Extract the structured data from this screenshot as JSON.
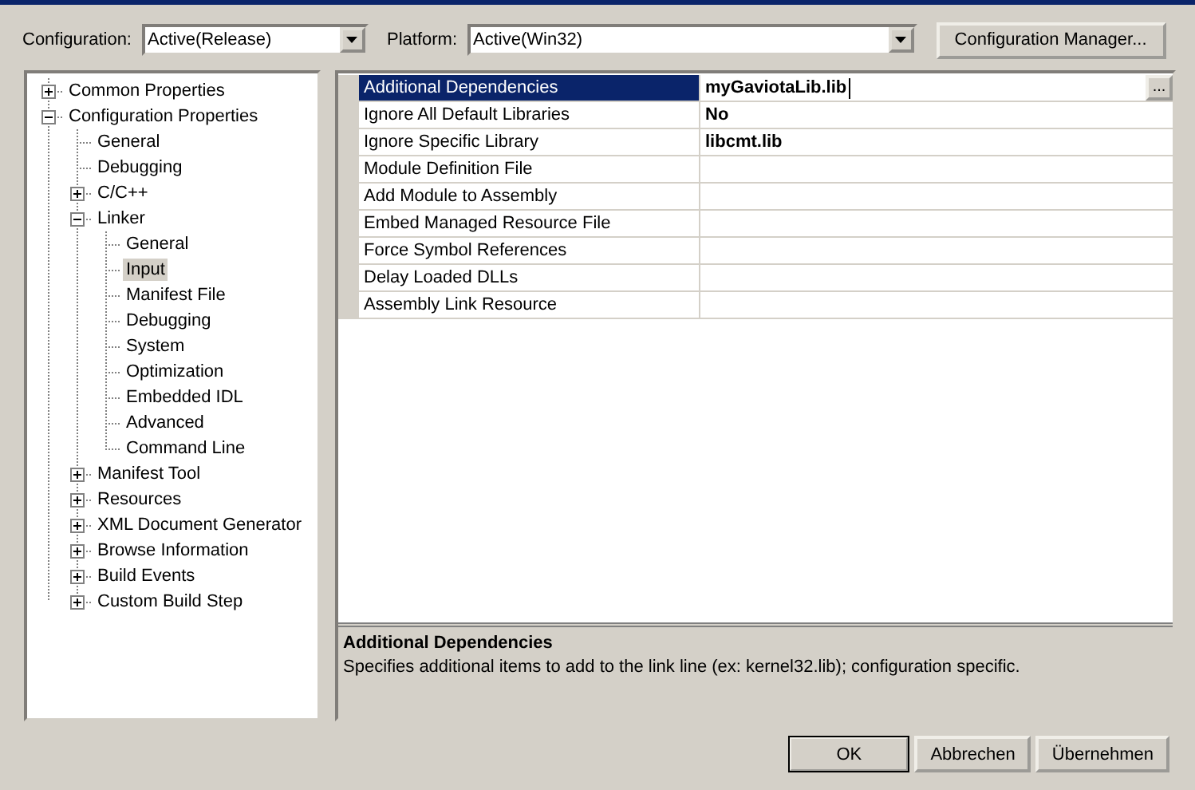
{
  "toolbar": {
    "configuration_label": "Configuration:",
    "configuration": "Active(Release)",
    "platform_label": "Platform:",
    "platform": "Active(Win32)",
    "manager_button": "Configuration Manager..."
  },
  "tree": [
    {
      "label": "Common Properties",
      "expanded": false,
      "selected": false
    },
    {
      "label": "Configuration Properties",
      "expanded": true,
      "selected": false,
      "children": [
        {
          "label": "General",
          "selected": false
        },
        {
          "label": "Debugging",
          "selected": false
        },
        {
          "label": "C/C++",
          "expanded": false,
          "selected": false
        },
        {
          "label": "Linker",
          "expanded": true,
          "selected": false,
          "children": [
            {
              "label": "General",
              "selected": false
            },
            {
              "label": "Input",
              "selected": true
            },
            {
              "label": "Manifest File",
              "selected": false
            },
            {
              "label": "Debugging",
              "selected": false
            },
            {
              "label": "System",
              "selected": false
            },
            {
              "label": "Optimization",
              "selected": false
            },
            {
              "label": "Embedded IDL",
              "selected": false
            },
            {
              "label": "Advanced",
              "selected": false
            },
            {
              "label": "Command Line",
              "selected": false
            }
          ]
        },
        {
          "label": "Manifest Tool",
          "expanded": false,
          "selected": false
        },
        {
          "label": "Resources",
          "expanded": false,
          "selected": false
        },
        {
          "label": "XML Document Generator",
          "expanded": false,
          "selected": false
        },
        {
          "label": "Browse Information",
          "expanded": false,
          "selected": false
        },
        {
          "label": "Build Events",
          "expanded": false,
          "selected": false
        },
        {
          "label": "Custom Build Step",
          "expanded": false,
          "selected": false
        }
      ]
    }
  ],
  "properties": [
    {
      "name": "Additional Dependencies",
      "value": "myGaviotaLib.lib",
      "selected": true
    },
    {
      "name": "Ignore All Default Libraries",
      "value": "No",
      "selected": false
    },
    {
      "name": "Ignore Specific Library",
      "value": "libcmt.lib",
      "selected": false
    },
    {
      "name": "Module Definition File",
      "selected": false
    },
    {
      "name": "Add Module to Assembly",
      "selected": false
    },
    {
      "name": "Embed Managed Resource File",
      "selected": false
    },
    {
      "name": "Force Symbol References",
      "selected": false
    },
    {
      "name": "Delay Loaded DLLs",
      "selected": false
    },
    {
      "name": "Assembly Link Resource",
      "selected": false
    }
  ],
  "edit_button": "...",
  "description": {
    "title": "Additional Dependencies",
    "text": "Specifies additional items to add to the link line (ex: kernel32.lib); configuration specific."
  },
  "buttons": [
    {
      "label": "OK",
      "default": true
    },
    {
      "label": "Abbrechen",
      "default": false
    },
    {
      "label": "Übernehmen",
      "default": false
    }
  ]
}
